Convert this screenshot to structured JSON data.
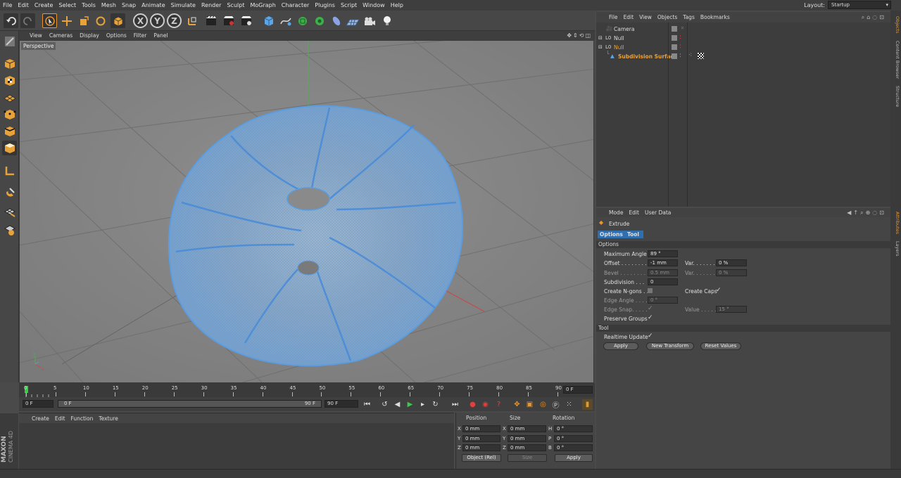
{
  "menubar": {
    "items": [
      "File",
      "Edit",
      "Create",
      "Select",
      "Tools",
      "Mesh",
      "Snap",
      "Animate",
      "Simulate",
      "Render",
      "Sculpt",
      "MoGraph",
      "Character",
      "Plugins",
      "Script",
      "Window",
      "Help"
    ],
    "layout_label": "Layout:",
    "layout_value": "Startup"
  },
  "toolbar": {
    "axis_x": "X",
    "axis_y": "Y",
    "axis_z": "Z"
  },
  "viewport": {
    "menu": [
      "View",
      "Cameras",
      "Display",
      "Options",
      "Filter",
      "Panel"
    ],
    "label": "Perspective"
  },
  "timeline": {
    "ticks": [
      "0",
      "5",
      "10",
      "15",
      "20",
      "25",
      "30",
      "35",
      "40",
      "45",
      "50",
      "55",
      "60",
      "65",
      "70",
      "75",
      "80",
      "85",
      "90"
    ],
    "current_frame": "0 F",
    "start_field": "0 F",
    "range_start": "0 F",
    "range_end": "90 F",
    "end_field": "90 F"
  },
  "material": {
    "menu": [
      "Create",
      "Edit",
      "Function",
      "Texture"
    ],
    "brand_top": "MAXON",
    "brand_bottom": "CINEMA 4D"
  },
  "coords": {
    "headers": [
      "Position",
      "Size",
      "Rotation"
    ],
    "rows": [
      {
        "axis": "X",
        "pos": "0 mm",
        "size_axis": "X",
        "size": "0 mm",
        "rot_axis": "H",
        "rot": "0 °"
      },
      {
        "axis": "Y",
        "pos": "0 mm",
        "size_axis": "Y",
        "size": "0 mm",
        "rot_axis": "P",
        "rot": "0 °"
      },
      {
        "axis": "Z",
        "pos": "0 mm",
        "size_axis": "Z",
        "size": "0 mm",
        "rot_axis": "B",
        "rot": "0 °"
      }
    ],
    "mode": "Object (Rel)",
    "size_mode": "Size",
    "apply": "Apply"
  },
  "objects": {
    "menu": [
      "File",
      "Edit",
      "View",
      "Objects",
      "Tags",
      "Bookmarks"
    ],
    "items": [
      {
        "name": "Camera",
        "color": "#dcdcdc"
      },
      {
        "name": "Null",
        "color": "#dcdcdc"
      },
      {
        "name": "Null",
        "color": "#e8a23a"
      },
      {
        "name": "Subdivision Surface",
        "color": "#f0a030"
      }
    ]
  },
  "attributes": {
    "menu": [
      "Mode",
      "Edit",
      "User Data"
    ],
    "object_name": "Extrude",
    "tabs": [
      "Options",
      "Tool"
    ],
    "section_options": "Options",
    "max_angle_label": "Maximum Angle",
    "max_angle": "89 °",
    "offset_label": "Offset . . . . . . . .",
    "offset": "-1 mm",
    "var1_label": "Var. . . . . . . .",
    "var1": "0 %",
    "bevel_label": "Bevel . . . . . . . . .",
    "bevel": "0.5 mm",
    "var2_label": "Var. . . . . . . .",
    "var2": "0 %",
    "subdivision_label": "Subdivision . . .",
    "subdivision": "0",
    "create_ngons_label": "Create N-gons . .",
    "create_caps_label": "Create Caps",
    "edge_angle_label": "Edge Angle . . . .",
    "edge_angle": "0 °",
    "edge_snap_label": "Edge Snap. . . . .",
    "value_label": "Value . . . . . .",
    "value": "15 °",
    "preserve_groups_label": "Preserve Groups",
    "section_tool": "Tool",
    "realtime_label": "Realtime Update",
    "apply": "Apply",
    "new_transform": "New Transform",
    "reset_values": "Reset Values"
  },
  "right_tabs": [
    "Objects",
    "Content Browser",
    "Structure",
    "Attributes",
    "Layers"
  ],
  "colors": {
    "accent_orange": "#e8962e",
    "wire_blue": "#5b9de0",
    "panel_bg": "#454545"
  }
}
